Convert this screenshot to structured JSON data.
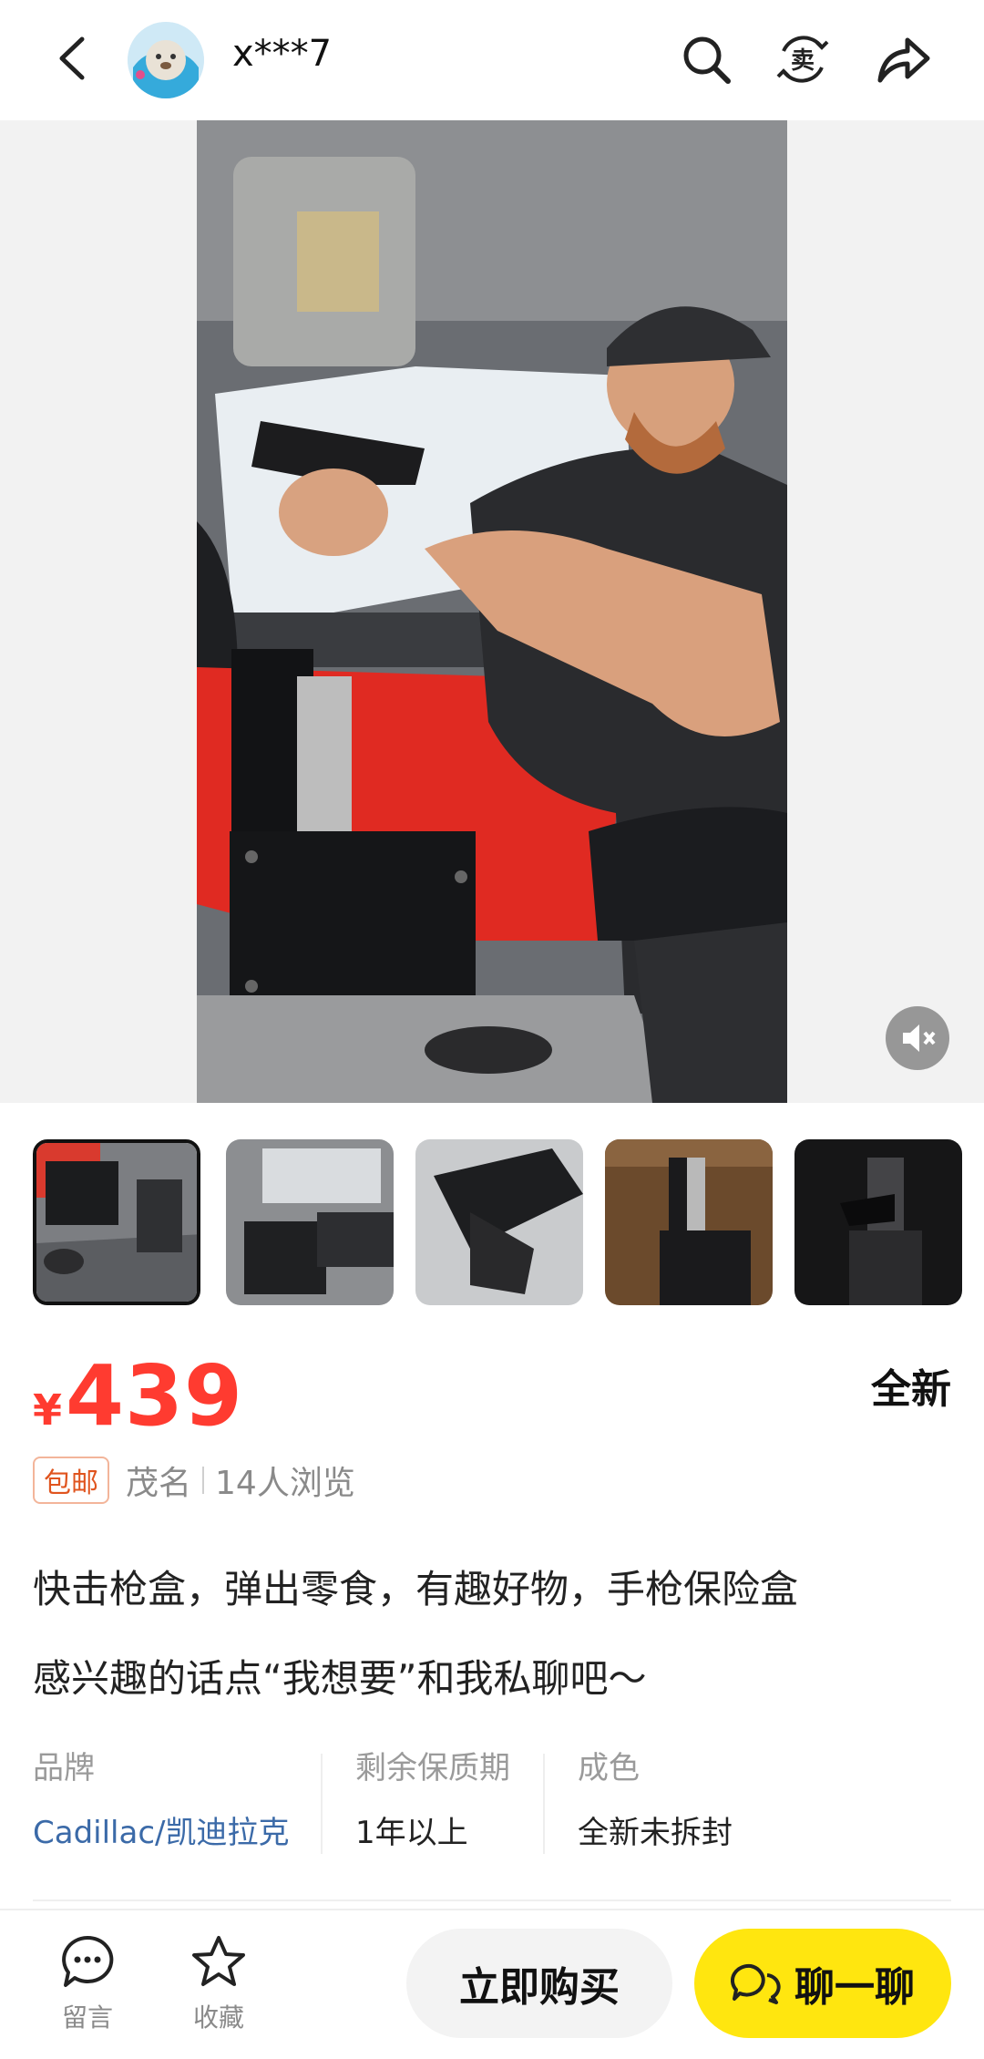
{
  "header": {
    "username": "x***7",
    "icons": [
      "back-arrow-icon",
      "search-icon",
      "sell-icon",
      "share-icon"
    ],
    "sell_icon_char": "卖"
  },
  "media": {
    "description": "Product video still",
    "mute_icon": "mute-icon"
  },
  "thumbnails": [
    {
      "name": "thumb-1",
      "active": true
    },
    {
      "name": "thumb-2",
      "active": false
    },
    {
      "name": "thumb-3",
      "active": false
    },
    {
      "name": "thumb-4",
      "active": false
    },
    {
      "name": "thumb-5",
      "active": false
    }
  ],
  "product": {
    "currency": "¥",
    "price": "439",
    "condition": "全新",
    "shipping_badge": "包邮",
    "location": "茂名",
    "views": "14人浏览",
    "title": "快击枪盒，弹出零食，有趣好物，手枪保险盒",
    "note": "感兴趣的话点“我想要”和我私聊吧～"
  },
  "specs": [
    {
      "key": "品牌",
      "value": "Cadillac/凯迪拉克"
    },
    {
      "key": "剩余保质期",
      "value": "1年以上"
    },
    {
      "key": "成色",
      "value": "全新未拆封"
    }
  ],
  "bottom_bar": {
    "comment_label": "留言",
    "favorite_label": "收藏",
    "buy_label": "立即购买",
    "chat_label": "聊一聊"
  },
  "colors": {
    "price_red": "#ff3b30",
    "chat_yellow": "#ffe60f",
    "link_blue": "#3b6aa8",
    "badge_orange": "#e0541e"
  }
}
